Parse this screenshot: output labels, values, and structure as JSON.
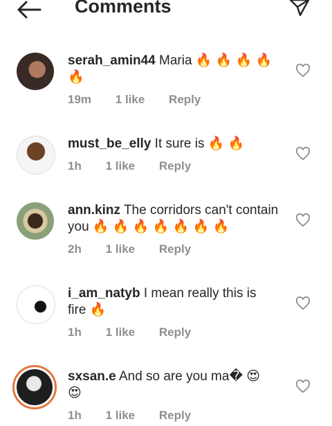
{
  "header": {
    "title": "Comments"
  },
  "comments": [
    {
      "user": "serah_amin44",
      "text": " Maria",
      "emoji": "🔥 🔥 🔥 🔥 🔥",
      "time": "19m",
      "likes": "1 like",
      "reply": "Reply"
    },
    {
      "user": "must_be_elly",
      "text": " It sure is",
      "emoji": "🔥 🔥",
      "time": "1h",
      "likes": "1 like",
      "reply": "Reply"
    },
    {
      "user": "ann.kinz",
      "text": " The corridors can't contain you",
      "emoji": "🔥 🔥 🔥 🔥 🔥 🔥 🔥",
      "time": "2h",
      "likes": "1 like",
      "reply": "Reply"
    },
    {
      "user": "i_am_natyb",
      "text": " I mean really this is fire",
      "emoji": "🔥",
      "time": "1h",
      "likes": "1 like",
      "reply": "Reply"
    },
    {
      "user": "sxsan.e",
      "text": " And so are you ma�",
      "emoji": "😍 😍",
      "time": "1h",
      "likes": "1 like",
      "reply": "Reply"
    }
  ],
  "colors": {
    "ring": "#e4763e",
    "meta": "#8e8e8e",
    "text": "#262626"
  },
  "icons": {
    "back": "arrow-left-icon",
    "send": "send-icon",
    "like": "heart-outline-icon"
  }
}
